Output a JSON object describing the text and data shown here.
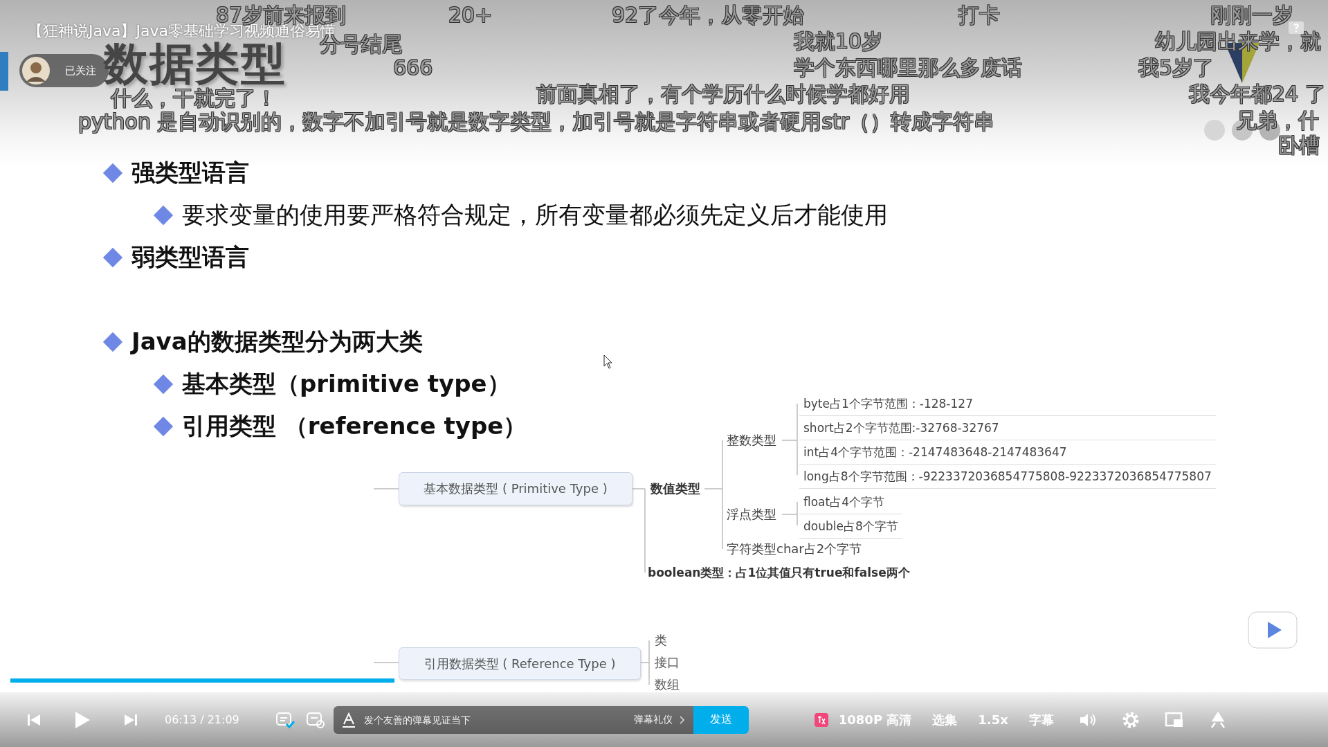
{
  "video_title": "【狂神说Java】Java零基础学习视频通俗易懂",
  "uploader": {
    "followed": true,
    "label": "已关注"
  },
  "slide": {
    "title": "数据类型",
    "bullets": [
      {
        "text": "强类型语言",
        "bold": true,
        "children": [
          {
            "text": "要求变量的使用要严格符合规定，所有变量都必须先定义后才能使用",
            "bold": false
          }
        ]
      },
      {
        "text": "弱类型语言",
        "bold": true
      },
      {
        "text": "Java的数据类型分为两大类",
        "bold": true,
        "children": [
          {
            "text": "基本类型（primitive type）",
            "bold": true
          },
          {
            "text": "引用类型 （reference type）",
            "bold": true
          }
        ]
      }
    ],
    "diagram": {
      "primitive": {
        "label": "基本数据类型 ( Primitive Type )",
        "numeric": "数值类型",
        "groups": [
          {
            "label": "整数类型",
            "items": [
              "byte占1个字节范围：-128-127",
              "short占2个字节范围:-32768-32767",
              "int占4个字节范围：-2147483648-2147483647",
              "long占8个字节范围：-9223372036854775808-9223372036854775807"
            ]
          },
          {
            "label": "浮点类型",
            "items": [
              "float占4个字节",
              "double占8个字节"
            ]
          }
        ],
        "char": "字符类型char占2个字节",
        "boolean": "boolean类型：占1位其值只有true和false两个"
      },
      "reference": {
        "label": "引用数据类型 ( Reference Type )",
        "items": [
          "类",
          "接口",
          "数组"
        ]
      }
    }
  },
  "danmaku": [
    {
      "text": "87岁前来报到"
    },
    {
      "text": "20+"
    },
    {
      "text": "92了今年，从零开始"
    },
    {
      "text": "打卡"
    },
    {
      "text": "刚刚一岁"
    },
    {
      "text": "分号结尾"
    },
    {
      "text": "我就10岁"
    },
    {
      "text": "幼儿园出来学，就"
    },
    {
      "text": "666"
    },
    {
      "text": "学个东西哪里那么多废话"
    },
    {
      "text": "我5岁了"
    },
    {
      "text": "什么，干就完了！"
    },
    {
      "text": "前面真相了，有个学历什么时候学都好用"
    },
    {
      "text": "我今年都24 了"
    },
    {
      "text": "python 是自动识别的，数字不加引号就是数字类型，加引号就是字符串或者硬用str（）转成字符串"
    },
    {
      "text": "兄弟，什"
    },
    {
      "text": "卧槽"
    }
  ],
  "player": {
    "progress": {
      "level": 0.294
    },
    "time": "06:13 / 21:09",
    "danmaku_on": true,
    "comment_field": {
      "placeholder": "发个友善的弹幕见证当下"
    },
    "etiquette_link": "弹幕礼仪",
    "send_button": "发送",
    "quality": "1080P 高清",
    "episodes": "选集",
    "speed": "1.5x",
    "subtitles": "字幕"
  }
}
